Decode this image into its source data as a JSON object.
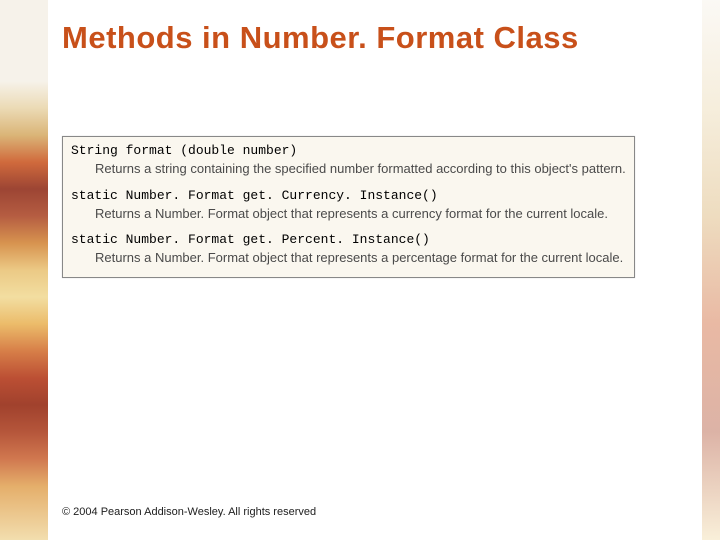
{
  "title": "Methods in Number. Format Class",
  "methods": [
    {
      "signature": "String format (double number)",
      "description": "Returns a string containing the specified number formatted according to this object's pattern."
    },
    {
      "signature": "static Number. Format get. Currency. Instance()",
      "description": "Returns a Number. Format object that represents a currency format for the current locale."
    },
    {
      "signature": "static Number. Format get. Percent. Instance()",
      "description": "Returns a Number. Format object that represents a percentage format for the current locale."
    }
  ],
  "footer": "© 2004 Pearson Addison-Wesley. All rights reserved"
}
